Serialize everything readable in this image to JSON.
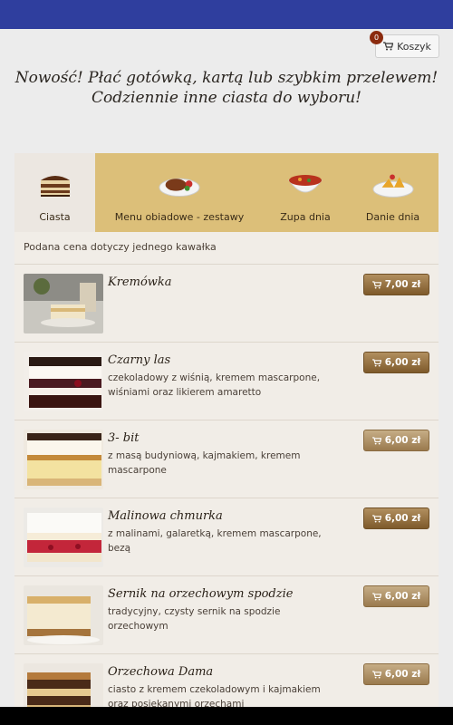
{
  "cart": {
    "count": "0",
    "label": "Koszyk"
  },
  "headline": {
    "line1": "Nowość! Płać gotówką, kartą lub szybkim przelewem!",
    "line2": "Codziennie inne ciasta do wyboru!"
  },
  "tabs": [
    {
      "label": "Ciasta",
      "icon": "cake-icon"
    },
    {
      "label": "Menu obiadowe - zestawy",
      "icon": "steak-plate-icon"
    },
    {
      "label": "Zupa dnia",
      "icon": "soup-bowl-icon"
    },
    {
      "label": "Danie dnia",
      "icon": "pasta-plate-icon"
    }
  ],
  "note": "Podana cena dotyczy jednego kawałka",
  "products": [
    {
      "name": "Kremówka",
      "desc": "",
      "price": "7,00 zł"
    },
    {
      "name": "Czarny las",
      "desc": "czekoladowy z wiśnią, kremem mascarpone, wiśniami oraz likierem amaretto",
      "price": "6,00 zł"
    },
    {
      "name": "3- bit",
      "desc": "z masą budyniową, kajmakiem, kremem mascarpone",
      "price": "6,00 zł"
    },
    {
      "name": "Malinowa chmurka",
      "desc": "z malinami, galaretką, kremem mascarpone, bezą",
      "price": "6,00 zł"
    },
    {
      "name": "Sernik na orzechowym spodzie",
      "desc": "tradycyjny, czysty sernik na spodzie orzechowym",
      "price": "6,00 zł"
    },
    {
      "name": "Orzechowa Dama",
      "desc": "ciasto z kremem czekoladowym i kajmakiem oraz posiekanymi orzechami",
      "price": "6,00 zł"
    }
  ],
  "colors": {
    "topbar": "#2f3e9e",
    "tabs_bg": "#dcbf79",
    "price_button": "#8a6533",
    "badge": "#8b2b0e"
  }
}
